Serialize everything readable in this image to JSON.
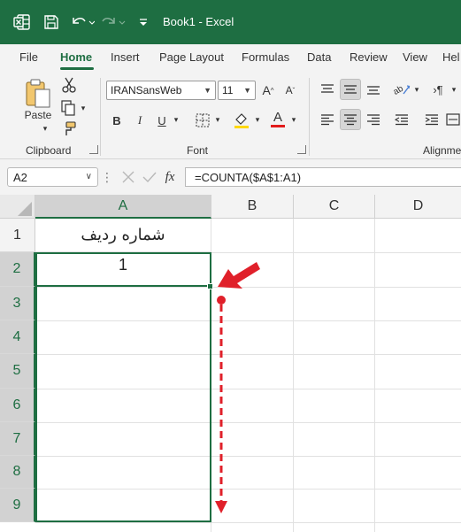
{
  "titlebar": {
    "title": "Book1  -  Excel",
    "icons": [
      "excel-logo-icon",
      "save-icon",
      "undo-icon",
      "redo-icon",
      "customize-qat-icon"
    ],
    "bg_color": "#1e6e42"
  },
  "tabs": [
    {
      "label": "File",
      "active": false
    },
    {
      "label": "Home",
      "active": true
    },
    {
      "label": "Insert",
      "active": false
    },
    {
      "label": "Page Layout",
      "active": false
    },
    {
      "label": "Formulas",
      "active": false
    },
    {
      "label": "Data",
      "active": false
    },
    {
      "label": "Review",
      "active": false
    },
    {
      "label": "View",
      "active": false
    },
    {
      "label": "Hel",
      "active": false
    }
  ],
  "ribbon": {
    "clipboard": {
      "paste_label": "Paste",
      "group_label": "Clipboard"
    },
    "font": {
      "font_name": "IRANSansWeb",
      "font_size": "11",
      "grow_font": "A^",
      "shrink_font": "Aˇ",
      "bold": "B",
      "italic": "I",
      "underline": "U",
      "font_color_letter": "A",
      "group_label": "Font",
      "highlight_color": "#ffd800",
      "font_color": "#e21c1c"
    },
    "alignment": {
      "group_label": "Alignme"
    }
  },
  "formula_bar": {
    "name_box": "A2",
    "formula": "=COUNTA($A$1:A1)",
    "fx_label": "fx"
  },
  "grid": {
    "columns": [
      "A",
      "B",
      "C",
      "D"
    ],
    "rows": [
      "1",
      "2",
      "3",
      "4",
      "5",
      "6",
      "7",
      "8",
      "9"
    ],
    "selected_column": "A",
    "cells": {
      "A1": "شماره ردیف",
      "A2": "1"
    },
    "accent_color": "#1e6e42",
    "annotation_color": "#e0202a"
  }
}
